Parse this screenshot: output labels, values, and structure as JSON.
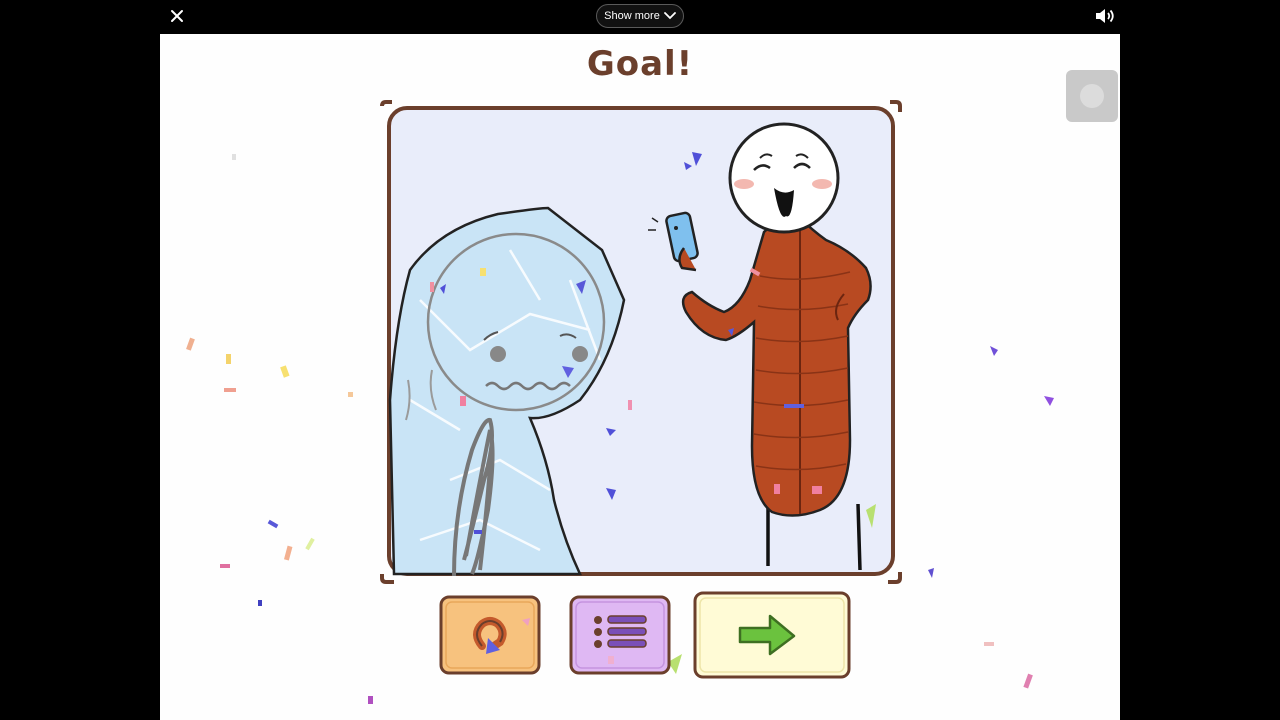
{
  "topbar": {
    "close_icon": "close-icon",
    "show_more_label": "Show more",
    "chevron_icon": "chevron-down-icon",
    "volume_icon": "volume-icon"
  },
  "game": {
    "title": "Goal!",
    "record_icon": "record-icon",
    "buttons": {
      "restart_icon": "restart-icon",
      "menu_icon": "list-menu-icon",
      "next_icon": "arrow-right-icon"
    },
    "colors": {
      "title": "#6b3f2c",
      "frame": "#6b3f2c",
      "scene_bg": "#e9edfa",
      "ice": "#c9e4f6",
      "coat": "#b84a22",
      "phone": "#7fc0ee",
      "restart_btn": "#f7c27e",
      "menu_btn": "#dfb8f3",
      "next_btn": "#fffbd6",
      "arrow": "#6bc23e"
    }
  }
}
